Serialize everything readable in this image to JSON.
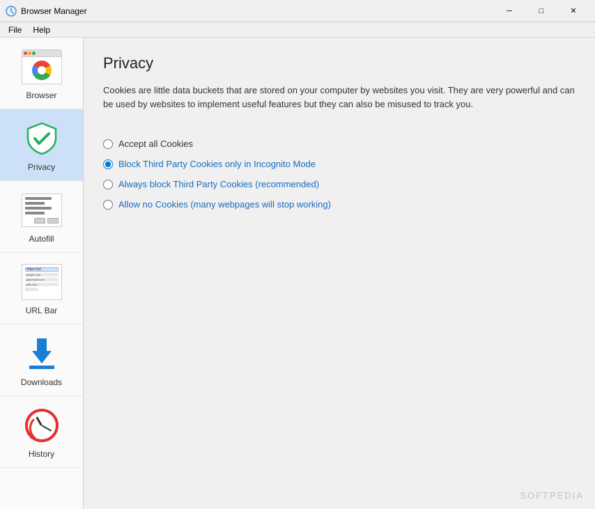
{
  "titlebar": {
    "icon": "⚙",
    "title": "Browser Manager",
    "minimize_label": "─",
    "maximize_label": "□",
    "close_label": "✕"
  },
  "menubar": {
    "items": [
      {
        "id": "file",
        "label": "File"
      },
      {
        "id": "help",
        "label": "Help"
      }
    ]
  },
  "sidebar": {
    "items": [
      {
        "id": "browser",
        "label": "Browser",
        "active": false
      },
      {
        "id": "privacy",
        "label": "Privacy",
        "active": true
      },
      {
        "id": "autofill",
        "label": "Autofill",
        "active": false
      },
      {
        "id": "urlbar",
        "label": "URL Bar",
        "active": false
      },
      {
        "id": "downloads",
        "label": "Downloads",
        "active": false
      },
      {
        "id": "history",
        "label": "History",
        "active": false
      }
    ]
  },
  "content": {
    "title": "Privacy",
    "description": "Cookies are little data buckets that are stored on your computer by websites you visit. They are very powerful and can be used by websites to implement useful features but they can also be misused to track you.",
    "radio_options": [
      {
        "id": "accept-all",
        "label": "Accept all Cookies",
        "checked": false,
        "highlight": ""
      },
      {
        "id": "block-third-party-incognito",
        "label": "Block Third Party Cookies only in Incognito Mode",
        "checked": true,
        "highlight": "Block Third Party Cookies only in Incognito Mode"
      },
      {
        "id": "always-block",
        "label": "Always block Third Party Cookies (recommended)",
        "checked": false,
        "highlight": "Always block Third Party Cookies (recommended)"
      },
      {
        "id": "allow-none",
        "label": "Allow no Cookies (many webpages will stop working)",
        "checked": false,
        "highlight": "Allow no Cookies (many webpages will stop working)"
      }
    ]
  },
  "watermark": {
    "text": "SOFTPEDIA"
  }
}
